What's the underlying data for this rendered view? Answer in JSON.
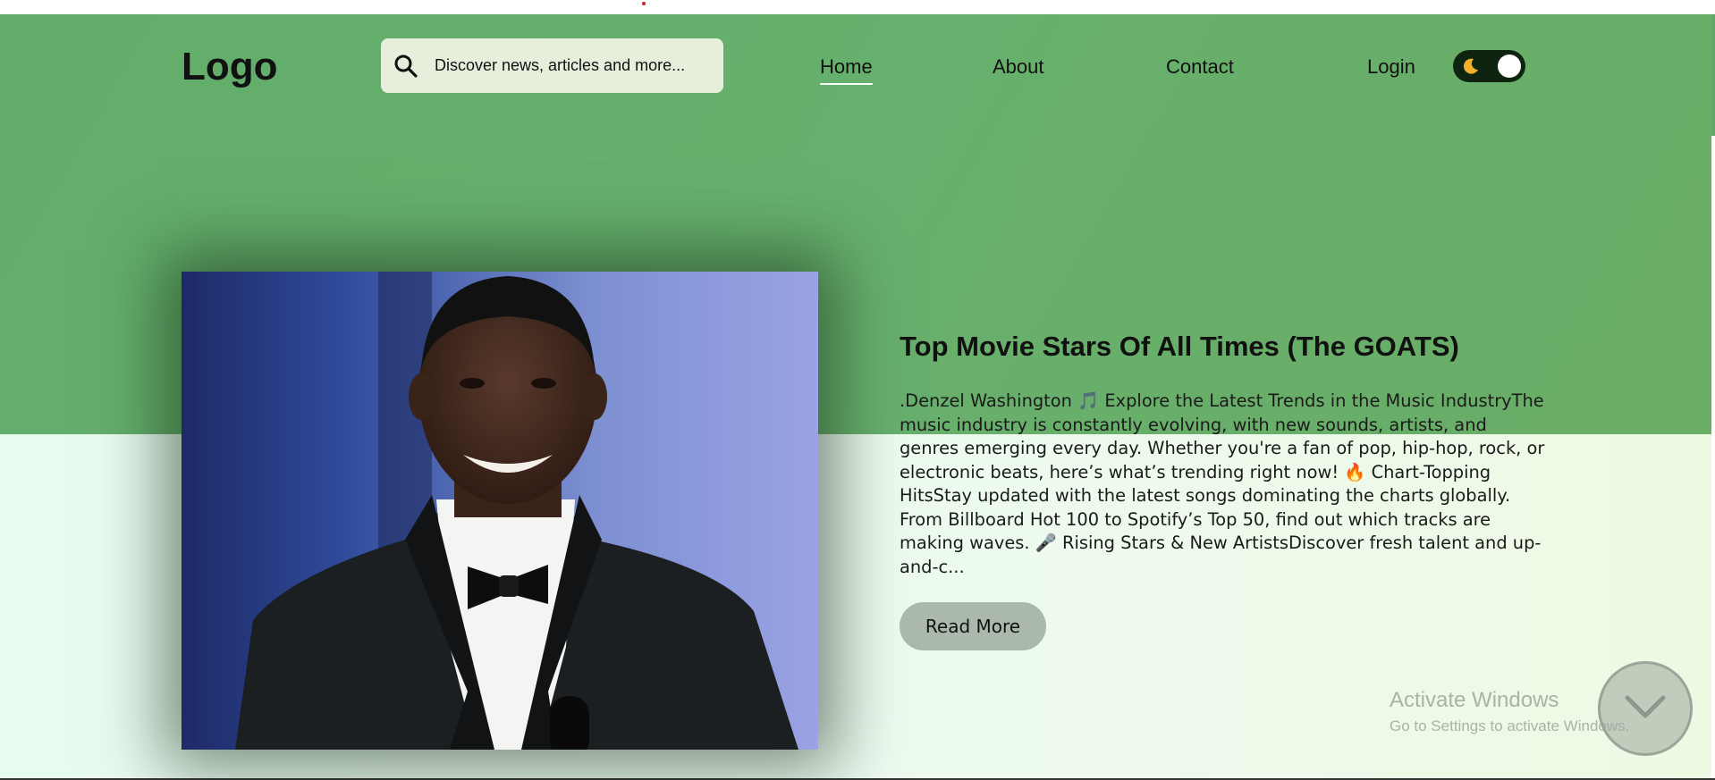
{
  "header": {
    "logo": "Logo",
    "search": {
      "placeholder": "Discover news, articles and more..."
    },
    "nav": [
      {
        "label": "Home",
        "active": true
      },
      {
        "label": "About"
      },
      {
        "label": "Contact"
      }
    ],
    "login_label": "Login",
    "theme_toggle": {
      "icon": "moon-icon",
      "state": "dark"
    }
  },
  "featured": {
    "title": "Top Movie Stars Of All Times (The GOATS)",
    "excerpt": ".Denzel Washington 🎵 Explore the Latest Trends in the Music IndustryThe music industry is constantly evolving, with new sounds, artists, and genres emerging every day. Whether you're a fan of pop, hip-hop, rock, or electronic beats, here’s what’s trending right now! 🔥 Chart-Topping HitsStay updated with the latest songs dominating the charts globally. From Billboard Hot 100 to Spotify’s Top 50, find out which tracks are making waves. 🎤 Rising Stars & New ArtistsDiscover fresh talent and up-and-c...",
    "read_more_label": "Read More"
  },
  "watermark": {
    "title": "Activate Windows",
    "subtitle": "Go to Settings to activate Windows."
  },
  "colors": {
    "hero_green": "#66af6b",
    "hero_light": "#ebfbef",
    "button_bg": "#aab9ab",
    "search_bg": "#e6efdc",
    "toggle_bg": "#0e2411"
  }
}
